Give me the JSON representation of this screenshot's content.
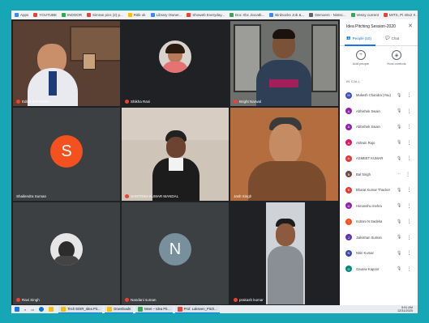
{
  "bookmarks": [
    {
      "label": "Apps",
      "color": "#4285f4"
    },
    {
      "label": "YOUTUBE",
      "color": "#ea4335"
    },
    {
      "label": "INDOOR",
      "color": "#34a853"
    },
    {
      "label": "Simran pics (2) p...",
      "color": "#ea4335"
    },
    {
      "label": "Ritik ok",
      "color": "#fbbc05"
    },
    {
      "label": "Library Owner...",
      "color": "#4285f4"
    },
    {
      "label": "Showeb Everyday...",
      "color": "#ea4335"
    },
    {
      "label": "Doc Xbc Jiocatb...",
      "color": "#34a853"
    },
    {
      "label": "Birdsocks Job &...",
      "color": "#4285f4"
    },
    {
      "label": "Demoers - Nistsc...",
      "color": "#5f6368"
    },
    {
      "label": "Vessy current",
      "color": "#34a853"
    },
    {
      "label": "MITS, Pi 40x2 X...",
      "color": "#ea4335"
    },
    {
      "label": "MITS, Pi 40x1 X-C...",
      "color": "#ea4335"
    },
    {
      "label": "Other bookmarks",
      "color": "#fbbc05"
    }
  ],
  "tiles": [
    {
      "id": "t1",
      "name": "Editor ETHAINIA",
      "kind": "video"
    },
    {
      "id": "t2",
      "name": "Shikha Rani",
      "kind": "video"
    },
    {
      "id": "t3",
      "name": "Bright Narwal",
      "kind": "video"
    },
    {
      "id": "t4",
      "name": "Shailendra Suman",
      "kind": "avatar",
      "initial": "S",
      "color": "#f4511e"
    },
    {
      "id": "t5",
      "name": "SANTOSH KUMAR MANDAL",
      "kind": "video"
    },
    {
      "id": "t6",
      "name": "Jash Singh",
      "kind": "video"
    },
    {
      "id": "t7",
      "name": "Ravi Singh",
      "kind": "video"
    },
    {
      "id": "t8",
      "name": "Nandani suman",
      "kind": "avatar",
      "initial": "N",
      "color": "#78909c"
    },
    {
      "id": "t9",
      "name": "prakash kumar",
      "kind": "video"
    }
  ],
  "panel": {
    "title": "Idea Pitching Session-2020",
    "close": "✕",
    "tab_people": "People (10)",
    "tab_chat": "Chat",
    "add_people": "Add people",
    "host_controls": "Host controls",
    "in_call_label": "IN CALL",
    "participants": [
      {
        "name": "Mukesh Chandra (You)",
        "initial": "M",
        "color": "#3f51b5",
        "mic": "🎙"
      },
      {
        "name": "Abhishek Swain",
        "initial": "A",
        "color": "#8e24aa",
        "mic": "🎙"
      },
      {
        "name": "Abhishek Swain",
        "initial": "A",
        "color": "#8e24aa",
        "mic": "🎙"
      },
      {
        "name": "Ashwin Rajo",
        "initial": "A",
        "color": "#d81b60",
        "mic": "🎙"
      },
      {
        "name": "ASMEET KUMAR",
        "initial": "A",
        "color": "#e53935",
        "mic": "🎙"
      },
      {
        "name": "Bal Singh",
        "initial": "B",
        "color": "#6d4c41",
        "mic": "⋯"
      },
      {
        "name": "Bharat Kumar Thacker",
        "initial": "B",
        "color": "#e53935",
        "mic": "🎙"
      },
      {
        "name": "Himanshu mehra",
        "initial": "H",
        "color": "#8e24aa",
        "mic": "🎙"
      },
      {
        "name": "Indrani N Sadeka",
        "initial": "I",
        "color": "#f4511e",
        "mic": "🎙"
      },
      {
        "name": "Jaikishan Suman",
        "initial": "J",
        "color": "#5e35b1",
        "mic": "🎙"
      },
      {
        "name": "Nitin Kumar",
        "initial": "N",
        "color": "#3949ab",
        "mic": "🎙"
      },
      {
        "name": "Gaurav Kapoor",
        "initial": "G",
        "color": "#00897b",
        "mic": "🎙"
      }
    ]
  },
  "taskbar": {
    "apps": [
      {
        "label": "Tech EDIR_Idea Pit...",
        "color": "#fbbc05"
      },
      {
        "label": "Downloads",
        "color": "#fbbc05"
      },
      {
        "label": "Meet – Idea Pit...",
        "color": "#34a853"
      },
      {
        "label": "Prof. Lakseen_Pitch...",
        "color": "#ea4335"
      }
    ],
    "time": "5:51 AM",
    "date": "12/31/2020"
  }
}
